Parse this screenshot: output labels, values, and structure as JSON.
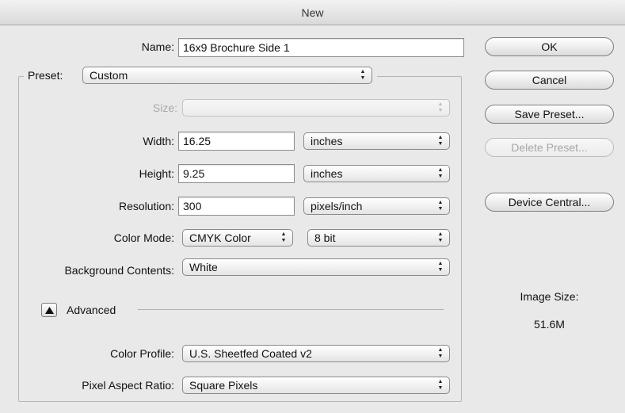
{
  "window": {
    "title": "New"
  },
  "form": {
    "name": {
      "label": "Name:",
      "value": "16x9 Brochure Side 1"
    },
    "preset": {
      "label": "Preset:",
      "value": "Custom"
    },
    "size": {
      "label": "Size:",
      "value": ""
    },
    "width": {
      "label": "Width:",
      "value": "16.25",
      "unit": "inches"
    },
    "height": {
      "label": "Height:",
      "value": "9.25",
      "unit": "inches"
    },
    "resolution": {
      "label": "Resolution:",
      "value": "300",
      "unit": "pixels/inch"
    },
    "color_mode": {
      "label": "Color Mode:",
      "value": "CMYK Color",
      "depth": "8 bit"
    },
    "background": {
      "label": "Background Contents:",
      "value": "White"
    },
    "advanced": {
      "label": "Advanced"
    },
    "color_profile": {
      "label": "Color Profile:",
      "value": "U.S. Sheetfed Coated v2"
    },
    "pixel_aspect": {
      "label": "Pixel Aspect Ratio:",
      "value": "Square Pixels"
    }
  },
  "buttons": {
    "ok": "OK",
    "cancel": "Cancel",
    "save_preset": "Save Preset...",
    "delete_preset": "Delete Preset...",
    "device_central": "Device Central..."
  },
  "image_size": {
    "label": "Image Size:",
    "value": "51.6M"
  }
}
